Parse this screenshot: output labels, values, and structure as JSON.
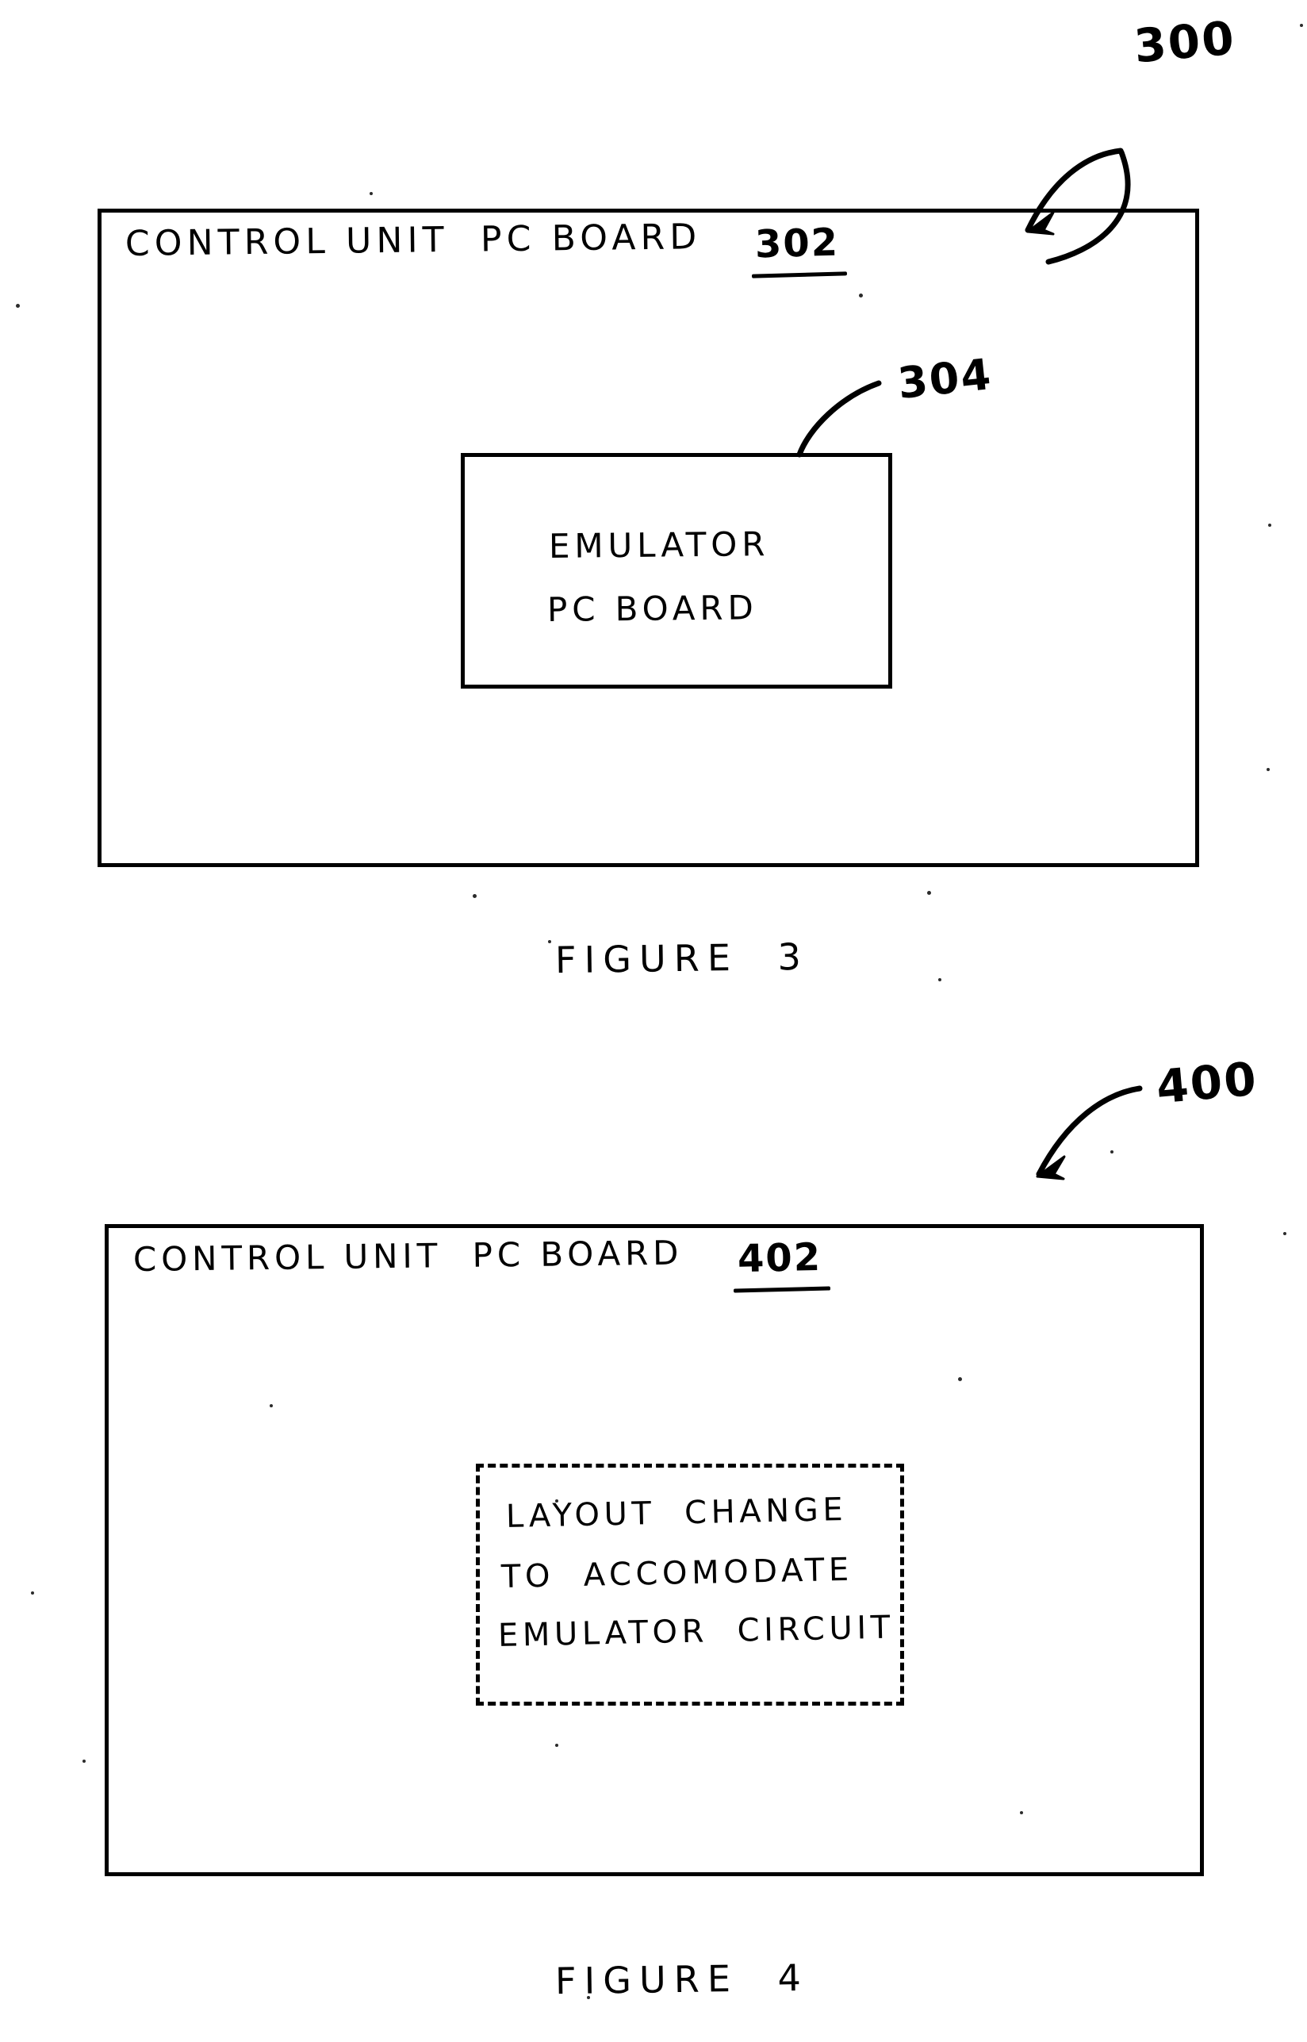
{
  "document": {
    "type": "patent-drawing-sheet",
    "background_color": "#ffffff",
    "ink_color": "#000000"
  },
  "figures": [
    {
      "id": "figure-3",
      "caption": "FIGURE  3",
      "callout": {
        "label": "300",
        "kind": "curved-arrow-pointing-down-left"
      },
      "outer_box": {
        "title_text": "CONTROL UNIT  PC BOARD",
        "reference_numeral": "302",
        "reference_underlined": true,
        "border_style": "solid"
      },
      "inner_box": {
        "label_line_1": "EMULATOR",
        "label_line_2": "PC BOARD",
        "reference_numeral": "304",
        "border_style": "solid",
        "leader": "curved-line-from-top-edge-to-numeral"
      }
    },
    {
      "id": "figure-4",
      "caption": "FIGURE  4",
      "callout": {
        "label": "400",
        "kind": "curved-arrow-pointing-down-left"
      },
      "outer_box": {
        "title_text": "CONTROL UNIT  PC BOARD",
        "reference_numeral": "402",
        "reference_underlined": true,
        "border_style": "solid"
      },
      "inner_box": {
        "label_line_1": "LAYOUT  CHANGE",
        "label_line_2": "TO  ACCOMODATE",
        "label_line_3": "EMULATOR  CIRCUIT",
        "border_style": "dashed"
      }
    }
  ]
}
